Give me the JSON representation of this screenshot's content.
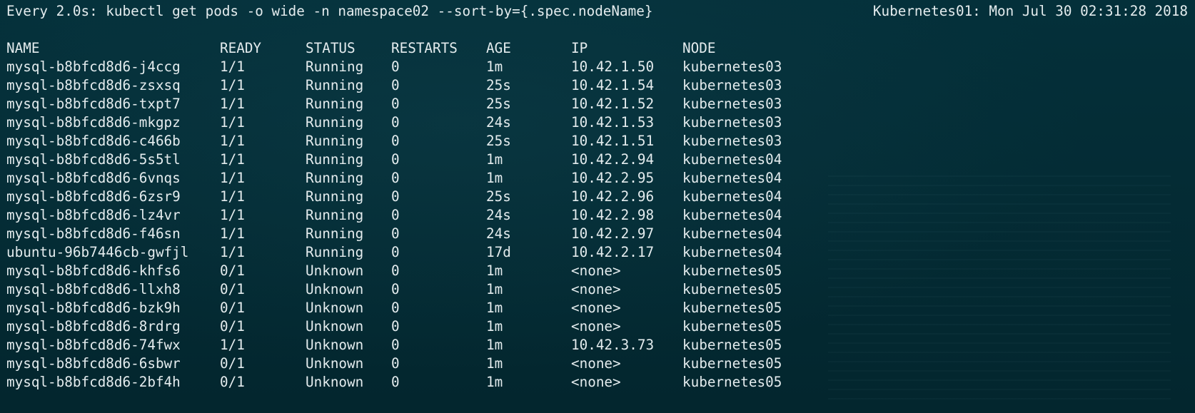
{
  "header": {
    "command": "Every 2.0s: kubectl get pods -o wide -n namespace02 --sort-by={.spec.nodeName}",
    "host_time": "Kubernetes01: Mon Jul 30 02:31:28 2018"
  },
  "table": {
    "columns": [
      "NAME",
      "READY",
      "STATUS",
      "RESTARTS",
      "AGE",
      "IP",
      "NODE"
    ],
    "rows": [
      [
        "mysql-b8bfcd8d6-j4ccg",
        "1/1",
        "Running",
        "0",
        "1m",
        "10.42.1.50",
        "kubernetes03"
      ],
      [
        "mysql-b8bfcd8d6-zsxsq",
        "1/1",
        "Running",
        "0",
        "25s",
        "10.42.1.54",
        "kubernetes03"
      ],
      [
        "mysql-b8bfcd8d6-txpt7",
        "1/1",
        "Running",
        "0",
        "25s",
        "10.42.1.52",
        "kubernetes03"
      ],
      [
        "mysql-b8bfcd8d6-mkgpz",
        "1/1",
        "Running",
        "0",
        "24s",
        "10.42.1.53",
        "kubernetes03"
      ],
      [
        "mysql-b8bfcd8d6-c466b",
        "1/1",
        "Running",
        "0",
        "25s",
        "10.42.1.51",
        "kubernetes03"
      ],
      [
        "mysql-b8bfcd8d6-5s5tl",
        "1/1",
        "Running",
        "0",
        "1m",
        "10.42.2.94",
        "kubernetes04"
      ],
      [
        "mysql-b8bfcd8d6-6vnqs",
        "1/1",
        "Running",
        "0",
        "1m",
        "10.42.2.95",
        "kubernetes04"
      ],
      [
        "mysql-b8bfcd8d6-6zsr9",
        "1/1",
        "Running",
        "0",
        "25s",
        "10.42.2.96",
        "kubernetes04"
      ],
      [
        "mysql-b8bfcd8d6-lz4vr",
        "1/1",
        "Running",
        "0",
        "24s",
        "10.42.2.98",
        "kubernetes04"
      ],
      [
        "mysql-b8bfcd8d6-f46sn",
        "1/1",
        "Running",
        "0",
        "24s",
        "10.42.2.97",
        "kubernetes04"
      ],
      [
        "ubuntu-96b7446cb-gwfjl",
        "1/1",
        "Running",
        "0",
        "17d",
        "10.42.2.17",
        "kubernetes04"
      ],
      [
        "mysql-b8bfcd8d6-khfs6",
        "0/1",
        "Unknown",
        "0",
        "1m",
        "<none>",
        "kubernetes05"
      ],
      [
        "mysql-b8bfcd8d6-llxh8",
        "0/1",
        "Unknown",
        "0",
        "1m",
        "<none>",
        "kubernetes05"
      ],
      [
        "mysql-b8bfcd8d6-bzk9h",
        "0/1",
        "Unknown",
        "0",
        "1m",
        "<none>",
        "kubernetes05"
      ],
      [
        "mysql-b8bfcd8d6-8rdrg",
        "0/1",
        "Unknown",
        "0",
        "1m",
        "<none>",
        "kubernetes05"
      ],
      [
        "mysql-b8bfcd8d6-74fwx",
        "1/1",
        "Unknown",
        "0",
        "1m",
        "10.42.3.73",
        "kubernetes05"
      ],
      [
        "mysql-b8bfcd8d6-6sbwr",
        "0/1",
        "Unknown",
        "0",
        "1m",
        "<none>",
        "kubernetes05"
      ],
      [
        "mysql-b8bfcd8d6-2bf4h",
        "0/1",
        "Unknown",
        "0",
        "1m",
        "<none>",
        "kubernetes05"
      ]
    ]
  },
  "colors": {
    "background": "#042b34",
    "text": "#e4ecee"
  }
}
